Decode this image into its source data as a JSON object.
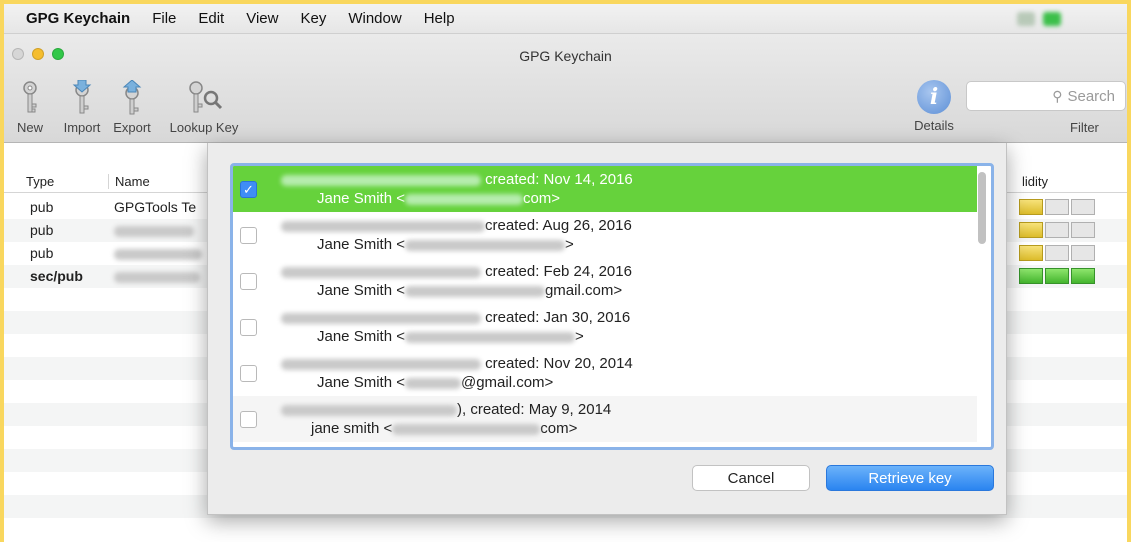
{
  "menubar": {
    "app_name": "GPG Keychain",
    "items": [
      "File",
      "Edit",
      "View",
      "Key",
      "Window",
      "Help"
    ]
  },
  "window": {
    "title": "GPG Keychain"
  },
  "toolbar": {
    "new_label": "New",
    "import_label": "Import",
    "export_label": "Export",
    "lookup_label": "Lookup Key",
    "details_label": "Details",
    "filter_label": "Filter",
    "search_placeholder": "Search"
  },
  "table": {
    "headers": {
      "type": "Type",
      "name": "Name",
      "validity": "lidity"
    },
    "rows": [
      {
        "type": "pub",
        "name": "GPGTools Te",
        "validity": [
          "yellow",
          "empty",
          "empty"
        ],
        "bold": false
      },
      {
        "type": "pub",
        "name": "",
        "validity": [
          "yellow",
          "empty",
          "empty"
        ],
        "bold": false
      },
      {
        "type": "pub",
        "name": "",
        "validity": [
          "yellow",
          "empty",
          "empty"
        ],
        "bold": false
      },
      {
        "type": "sec/pub",
        "name": "",
        "validity": [
          "green",
          "green",
          "green"
        ],
        "bold": true
      }
    ]
  },
  "dialog": {
    "results": [
      {
        "checked": true,
        "created": "created: Nov 14, 2016",
        "user": "Jane Smith <",
        "email_suffix": "com>"
      },
      {
        "checked": false,
        "created": "created: Aug 26, 2016",
        "user": "Jane Smith <",
        "email_suffix": ">"
      },
      {
        "checked": false,
        "created": "created: Feb 24, 2016",
        "user": "Jane Smith <",
        "email_suffix": "gmail.com>"
      },
      {
        "checked": false,
        "created": "created: Jan 30, 2016",
        "user": "Jane Smith <",
        "email_suffix": ">"
      },
      {
        "checked": false,
        "created": "created: Nov 20, 2014",
        "user": "Jane Smith <",
        "email_suffix": "@gmail.com>"
      },
      {
        "checked": false,
        "created": "), created: May 9, 2014",
        "user": "jane smith <",
        "email_suffix": "com>"
      }
    ],
    "cancel_label": "Cancel",
    "retrieve_label": "Retrieve key"
  },
  "colors": {
    "selection": "#66d23c",
    "accent": "#2a84f0",
    "frame": "#f9d75e"
  }
}
